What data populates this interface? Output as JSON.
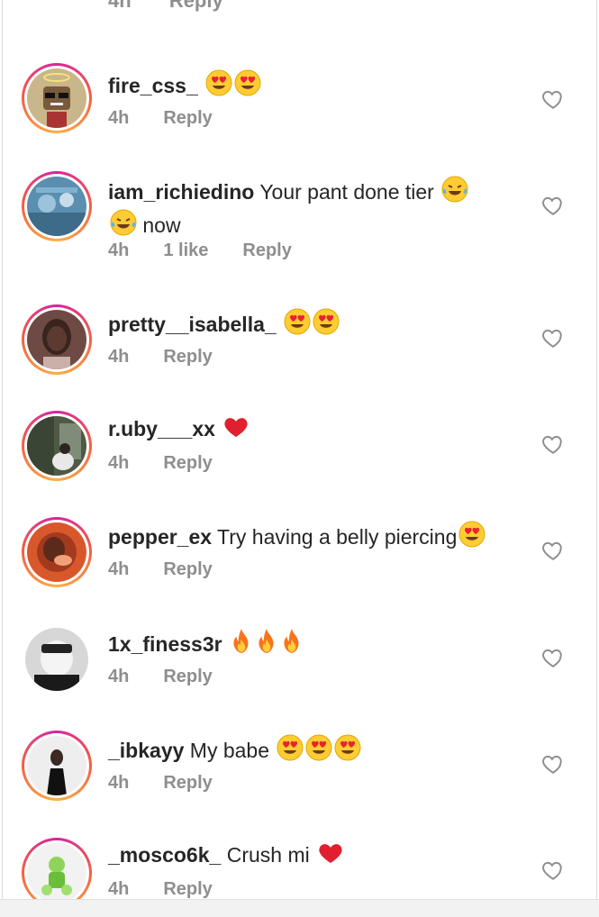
{
  "partial_comment": {
    "time": "4h",
    "reply_label": "Reply"
  },
  "colors": {
    "meta_text": "#8e8e8e",
    "body_text": "#262626",
    "story_ring": "#d6249f"
  },
  "comments": [
    {
      "username": "fire_css_",
      "text": "",
      "emojis": [
        "heart-eyes-emoji",
        "heart-eyes-emoji"
      ],
      "time": "4h",
      "likes": "",
      "reply_label": "Reply",
      "story_ring": true
    },
    {
      "username": "iam_richiedino",
      "text": "Your pant done tier",
      "text_after": "now",
      "emojis": [
        "tears-of-joy-emoji",
        "tears-of-joy-emoji"
      ],
      "time": "4h",
      "likes": "1 like",
      "reply_label": "Reply",
      "story_ring": true
    },
    {
      "username": "pretty__isabella_",
      "text": "",
      "emojis": [
        "heart-eyes-emoji",
        "heart-eyes-emoji"
      ],
      "time": "4h",
      "likes": "",
      "reply_label": "Reply",
      "story_ring": true
    },
    {
      "username": "r.uby___xx",
      "text": "",
      "emojis": [
        "red-heart-emoji"
      ],
      "time": "4h",
      "likes": "",
      "reply_label": "Reply",
      "story_ring": true
    },
    {
      "username": "pepper_ex",
      "text": "Try having a belly piercing",
      "emojis": [
        "heart-eyes-emoji"
      ],
      "time": "4h",
      "likes": "",
      "reply_label": "Reply",
      "story_ring": true
    },
    {
      "username": "1x_finess3r",
      "text": "",
      "emojis": [
        "fire-emoji",
        "fire-emoji",
        "fire-emoji"
      ],
      "time": "4h",
      "likes": "",
      "reply_label": "Reply",
      "story_ring": false
    },
    {
      "username": "_ibkayy",
      "text": "My babe",
      "emojis": [
        "heart-eyes-emoji",
        "heart-eyes-emoji",
        "heart-eyes-emoji"
      ],
      "time": "4h",
      "likes": "",
      "reply_label": "Reply",
      "story_ring": true
    },
    {
      "username": "_mosco6k_",
      "text": "Crush mi",
      "emojis": [
        "red-heart-emoji"
      ],
      "time": "4h",
      "likes": "",
      "reply_label": "Reply",
      "story_ring": true
    }
  ]
}
